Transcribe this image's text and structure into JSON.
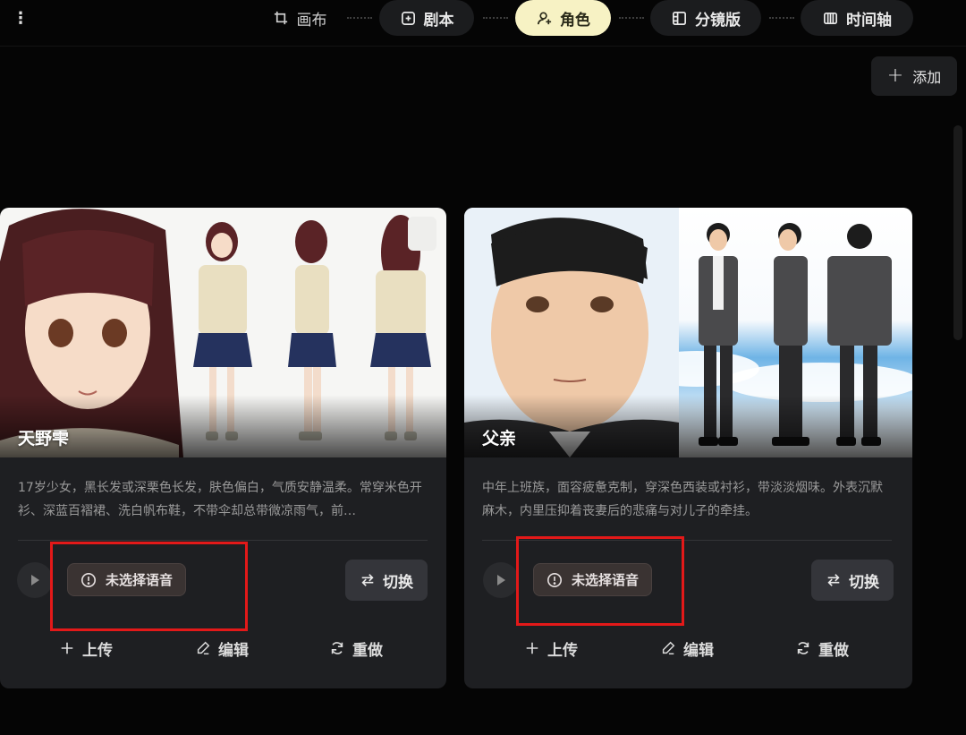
{
  "nav": {
    "steps": [
      {
        "label": "画布",
        "icon": "canvas-crop-icon"
      },
      {
        "label": "剧本",
        "icon": "script-icon"
      },
      {
        "label": "角色",
        "icon": "character-icon",
        "active": true
      },
      {
        "label": "分镜版",
        "icon": "storyboard-icon"
      },
      {
        "label": "时间轴",
        "icon": "timeline-icon"
      }
    ]
  },
  "add_label": "添加",
  "cards": [
    {
      "name": "天野雫",
      "description": "17岁少女，黑长发或深栗色长发，肤色偏白，气质安静温柔。常穿米色开衫、深蓝百褶裙、洗白帆布鞋，不带伞却总带微凉雨气，前…",
      "voice_status": "未选择语音",
      "switch_label": "切换",
      "actions": {
        "upload": "上传",
        "edit": "编辑",
        "redo": "重做"
      }
    },
    {
      "name": "父亲",
      "description": "中年上班族，面容疲惫克制，穿深色西装或衬衫，带淡淡烟味。外表沉默麻木，内里压抑着丧妻后的悲痛与对儿子的牵挂。",
      "voice_status": "未选择语音",
      "switch_label": "切换",
      "actions": {
        "upload": "上传",
        "edit": "编辑",
        "redo": "重做"
      }
    }
  ],
  "colors": {
    "background": "#050505",
    "card": "#1e1f22",
    "active_step": "#f7f2c4",
    "highlight": "#e31919"
  }
}
